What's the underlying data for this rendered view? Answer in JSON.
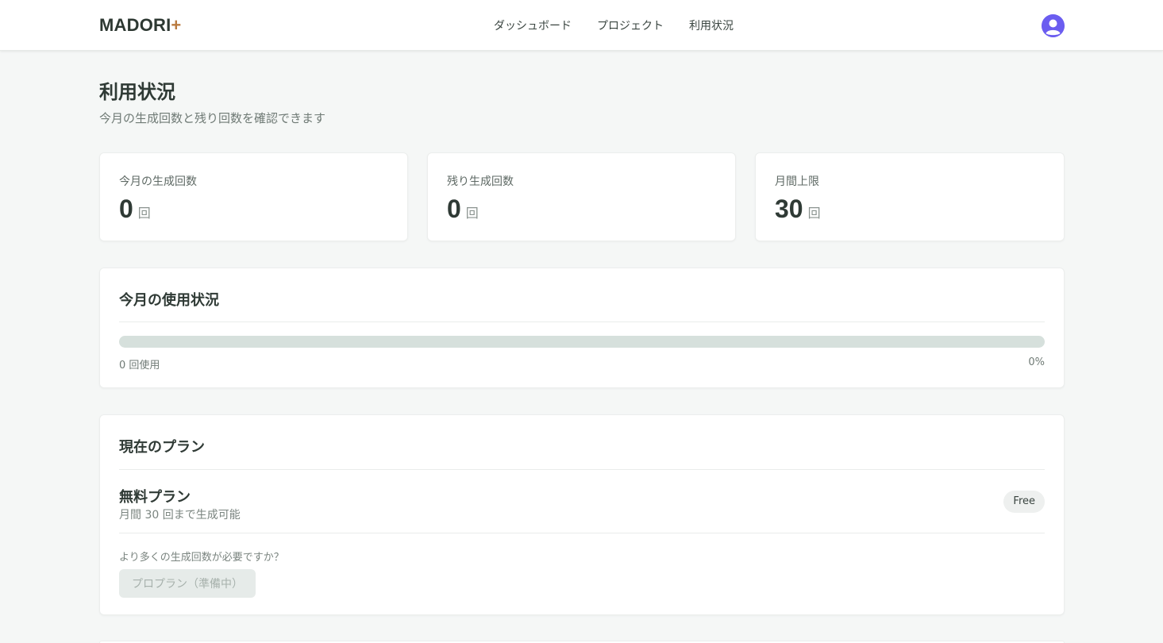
{
  "header": {
    "logo_text": "MADORI",
    "logo_plus": "+",
    "nav": [
      {
        "label": "ダッシュボード"
      },
      {
        "label": "プロジェクト"
      },
      {
        "label": "利用状況"
      }
    ],
    "avatar_icon": "user-avatar-icon"
  },
  "page": {
    "title": "利用状況",
    "subtitle": "今月の生成回数と残り回数を確認できます"
  },
  "stats": [
    {
      "label": "今月の生成回数",
      "value": "0",
      "unit": "回"
    },
    {
      "label": "残り生成回数",
      "value": "0",
      "unit": "回"
    },
    {
      "label": "月間上限",
      "value": "30",
      "unit": "回"
    }
  ],
  "usage": {
    "title": "今月の使用状況",
    "progress_percent": 0,
    "used_label": "0 回使用",
    "percent_label": "0%"
  },
  "plan": {
    "title": "現在のプラン",
    "name": "無料プラン",
    "description": "月間 30 回まで生成可能",
    "badge": "Free",
    "upsell_text": "より多くの生成回数が必要ですか？",
    "pro_button_label": "プロプラン（準備中）"
  },
  "colors": {
    "accent": "#6b5df0",
    "logo_plus": "#b97a3f",
    "progress_track": "#d6e0dc",
    "background": "#f5f7f6"
  }
}
